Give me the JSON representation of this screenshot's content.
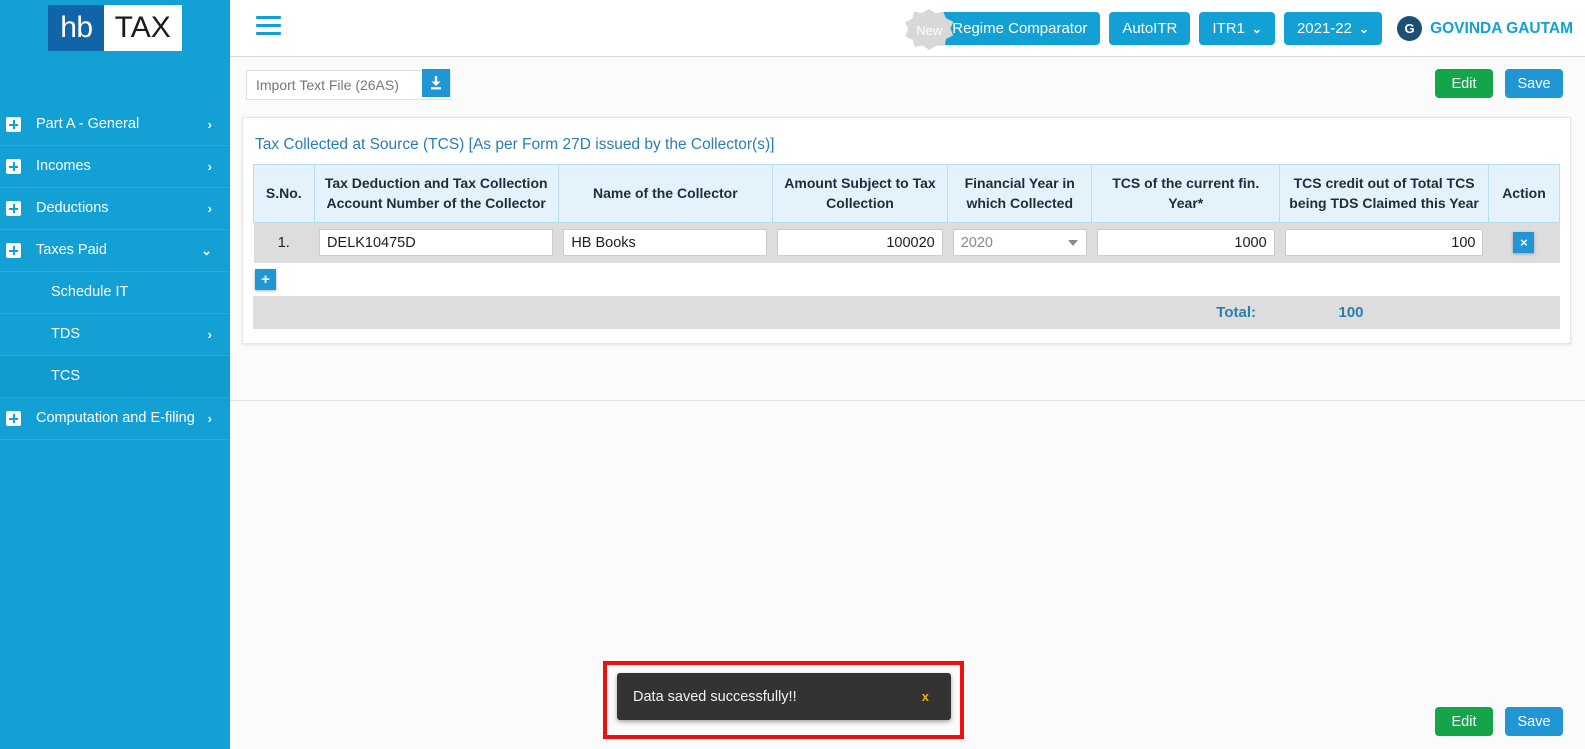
{
  "sidebar": {
    "logo": {
      "part1": "hb",
      "part2": "TAX"
    },
    "items": [
      {
        "label": "Part A - General",
        "icon": "plus-box-icon",
        "chevron": "›",
        "has_plus": true,
        "sub": false,
        "active": false
      },
      {
        "label": "Incomes",
        "icon": "plus-box-icon",
        "chevron": "›",
        "has_plus": true,
        "sub": false,
        "active": false
      },
      {
        "label": "Deductions",
        "icon": "plus-box-icon",
        "chevron": "›",
        "has_plus": true,
        "sub": false,
        "active": false
      },
      {
        "label": "Taxes Paid",
        "icon": "plus-box-icon",
        "chevron": "⌄",
        "has_plus": true,
        "sub": false,
        "active": false
      },
      {
        "label": "Schedule IT",
        "icon": "",
        "chevron": "",
        "has_plus": false,
        "sub": true,
        "active": false
      },
      {
        "label": "TDS",
        "icon": "",
        "chevron": "›",
        "has_plus": false,
        "sub": true,
        "active": false
      },
      {
        "label": "TCS",
        "icon": "",
        "chevron": "",
        "has_plus": false,
        "sub": true,
        "active": true
      },
      {
        "label": "Computation and E-filing",
        "icon": "plus-box-icon",
        "chevron": "›",
        "has_plus": true,
        "sub": false,
        "active": false
      }
    ]
  },
  "header": {
    "menu_icon": "hamburger-icon",
    "new_badge": "New",
    "regime_comparator": "Regime Comparator",
    "auto_itr": "AutoITR",
    "itr_form": "ITR1",
    "assessment_year": "2021-22",
    "avatar_initial": "G",
    "username": "GOVINDA GAUTAM",
    "caret": "⌄"
  },
  "toolbar": {
    "import_placeholder": "Import Text File (26AS)",
    "import_value": "",
    "download_icon": "download-icon",
    "edit_label": "Edit",
    "save_label": "Save"
  },
  "card": {
    "title": "Tax Collected at Source (TCS) [As per Form 27D issued by the Collector(s)]",
    "columns": [
      "S.No.",
      "Tax Deduction and Tax Collection Account Number of the Collector",
      "Name of the Collector",
      "Amount Subject to Tax Collection",
      "Financial Year in which Collected",
      "TCS of the current fin. Year*",
      "TCS credit out of Total TCS being TDS Claimed this Year",
      "Action"
    ],
    "rows": [
      {
        "sno": "1.",
        "tan": "DELK10475D",
        "collector_name": "HB Books",
        "amount_subject": "100020",
        "financial_year": "2020",
        "tcs_current_year": "1000",
        "tcs_credit_claimed": "100",
        "delete_label": "×"
      }
    ],
    "add_row_label": "+",
    "total_label": "Total:",
    "total_value": "100"
  },
  "footer": {
    "edit_label": "Edit",
    "save_label": "Save"
  },
  "toast": {
    "message": "Data saved successfully!!",
    "close_label": "x"
  },
  "colors": {
    "sidebar": "#13a0d4",
    "accent": "#2196d4",
    "success": "#14a44a",
    "header_link": "#13a0d4",
    "table_header": "#e4f2fb",
    "row_bg": "#dddddd",
    "toast_bg": "#333333",
    "toast_close": "#e8b21e",
    "highlight_outline": "#ee1111"
  }
}
